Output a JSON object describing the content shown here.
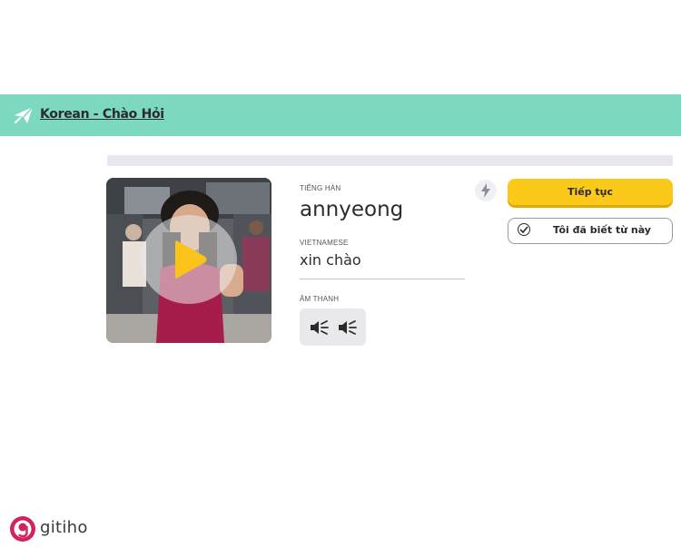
{
  "header": {
    "title": "Korean - Chào Hỏi",
    "icon": "paper-plane-icon",
    "color": "#7dd8c0"
  },
  "progress": {
    "value": 0.0
  },
  "video": {
    "play_icon": "play-icon"
  },
  "card": {
    "source_label": "TIẾNG HÀN",
    "word": "annyeong",
    "target_label": "VIETNAMESE",
    "translation": "xin chào",
    "audio_label": "ÂM THANH",
    "audio_icons": [
      "speaker-icon",
      "speaker-slow-icon"
    ]
  },
  "actions": {
    "continue_label": "Tiếp tục",
    "known_label": "Tôi đã biết từ này",
    "accent": "#fbc91a"
  },
  "watermark": {
    "text": "gitiho",
    "color": "#d1245a"
  }
}
